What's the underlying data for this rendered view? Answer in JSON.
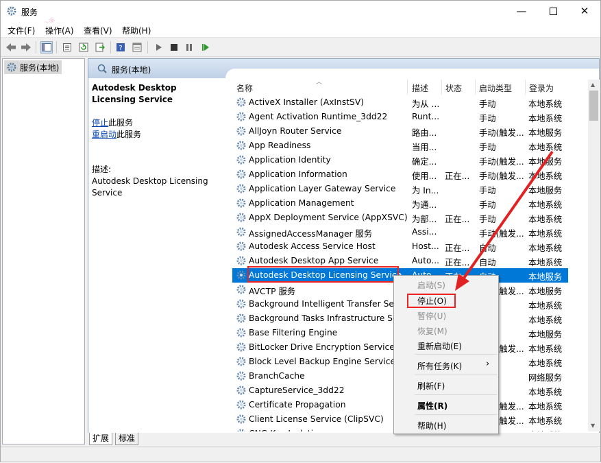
{
  "window": {
    "title": "服务",
    "watermark": "自学成才软件助手"
  },
  "menu": [
    "文件(F)",
    "操作(A)",
    "查看(V)",
    "帮助(H)"
  ],
  "tree": {
    "node": "服务(本地)"
  },
  "pane": {
    "header": "服务(本地)",
    "service_name": "Autodesk Desktop Licensing Service",
    "stop_link": "停止",
    "stop_suffix": "此服务",
    "restart_link": "重启动",
    "restart_suffix": "此服务",
    "desc_label": "描述:",
    "desc_text": "Autodesk Desktop Licensing Service"
  },
  "columns": [
    "名称",
    "描述",
    "状态",
    "启动类型",
    "登录为"
  ],
  "rows": [
    {
      "name": "ActiveX Installer (AxInstSV)",
      "desc": "为从 ...",
      "status": "",
      "type": "手动",
      "logon": "本地系统"
    },
    {
      "name": "Agent Activation Runtime_3dd22",
      "desc": "Runt...",
      "status": "",
      "type": "手动",
      "logon": "本地系统"
    },
    {
      "name": "AllJoyn Router Service",
      "desc": "路由...",
      "status": "",
      "type": "手动(触发...",
      "logon": "本地服务"
    },
    {
      "name": "App Readiness",
      "desc": "当用...",
      "status": "",
      "type": "手动",
      "logon": "本地系统"
    },
    {
      "name": "Application Identity",
      "desc": "确定...",
      "status": "",
      "type": "手动(触发...",
      "logon": "本地服务"
    },
    {
      "name": "Application Information",
      "desc": "使用...",
      "status": "正在...",
      "type": "手动(触发...",
      "logon": "本地系统"
    },
    {
      "name": "Application Layer Gateway Service",
      "desc": "为 In...",
      "status": "",
      "type": "手动",
      "logon": "本地服务"
    },
    {
      "name": "Application Management",
      "desc": "为通...",
      "status": "",
      "type": "手动",
      "logon": "本地系统"
    },
    {
      "name": "AppX Deployment Service (AppXSVC)",
      "desc": "为部...",
      "status": "正在...",
      "type": "手动",
      "logon": "本地系统"
    },
    {
      "name": "AssignedAccessManager 服务",
      "desc": "Assi...",
      "status": "",
      "type": "手动(触发...",
      "logon": "本地系统"
    },
    {
      "name": "Autodesk Access Service Host",
      "desc": "Host...",
      "status": "正在...",
      "type": "自动",
      "logon": "本地系统"
    },
    {
      "name": "Autodesk Desktop App Service",
      "desc": "Auto...",
      "status": "正在...",
      "type": "自动",
      "logon": "本地系统"
    },
    {
      "name": "Autodesk Desktop Licensing Service",
      "desc": "Auto...",
      "status": "正在...",
      "type": "自动",
      "logon": "本地服务"
    },
    {
      "name": "AVCTP 服务",
      "desc": "",
      "status": "",
      "type": "手动(触发...",
      "logon": "本地服务"
    },
    {
      "name": "Background Intelligent Transfer Service",
      "desc": "",
      "status": "",
      "type": "",
      "logon": "本地系统"
    },
    {
      "name": "Background Tasks Infrastructure Service",
      "desc": "",
      "status": "",
      "type": "",
      "logon": "本地系统"
    },
    {
      "name": "Base Filtering Engine",
      "desc": "",
      "status": "",
      "type": "",
      "logon": "本地服务"
    },
    {
      "name": "BitLocker Drive Encryption Service",
      "desc": "",
      "status": "",
      "type": "手动(触发...",
      "logon": "本地系统"
    },
    {
      "name": "Block Level Backup Engine Service",
      "desc": "",
      "status": "",
      "type": "",
      "logon": "本地系统"
    },
    {
      "name": "BranchCache",
      "desc": "",
      "status": "",
      "type": "",
      "logon": "网络服务"
    },
    {
      "name": "CaptureService_3dd22",
      "desc": "",
      "status": "",
      "type": "",
      "logon": "本地系统"
    },
    {
      "name": "Certificate Propagation",
      "desc": "",
      "status": "",
      "type": "手动(触发...",
      "logon": "本地系统"
    },
    {
      "name": "Client License Service (ClipSVC)",
      "desc": "",
      "status": "",
      "type": "手动(触发...",
      "logon": "本地系统"
    },
    {
      "name": "CNG Key Isolation",
      "desc": "",
      "status": "",
      "type": "",
      "logon": "本地系统"
    }
  ],
  "context_menu": {
    "start": "启动(S)",
    "stop": "停止(O)",
    "pause": "暂停(U)",
    "resume": "恢复(M)",
    "restart": "重新启动(E)",
    "all_tasks": "所有任务(K)",
    "refresh": "刷新(F)",
    "properties": "属性(R)",
    "help": "帮助(H)"
  },
  "tabs": [
    "扩展",
    "标准"
  ],
  "colors": {
    "selection": "#0078d7",
    "highlight": "#e22222",
    "link": "#0645ad"
  }
}
